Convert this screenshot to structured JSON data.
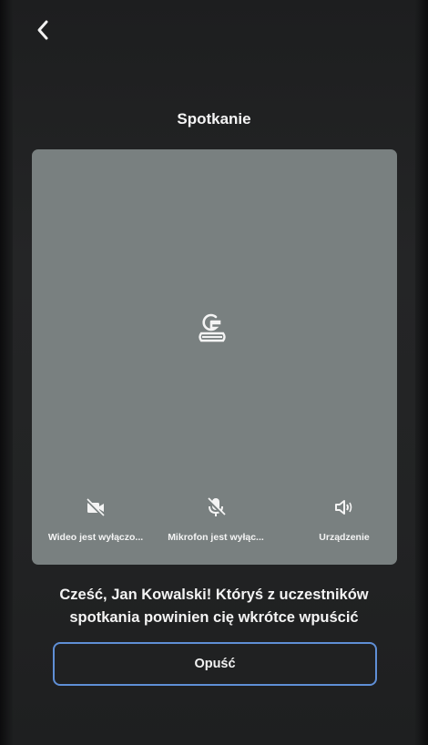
{
  "header": {
    "back_icon": "chevron-left-icon",
    "title": "Spotkanie"
  },
  "preview": {
    "avatar_icon": "user-placeholder-icon"
  },
  "controls": [
    {
      "label": "Wideo jest wyłączo...",
      "icon": "video-off-icon"
    },
    {
      "label": "Mikrofon jest wyłąc...",
      "icon": "microphone-off-icon"
    },
    {
      "label": "Urządzenie",
      "icon": "speaker-icon"
    }
  ],
  "lobby": {
    "message": "Cześć, Jan Kowalski! Któryś z uczestników spotkania powinien cię wkrótce wpuścić",
    "leave_label": "Opuść"
  },
  "colors": {
    "background": "#222324",
    "preview": "#798080",
    "button_border": "#5f8fd6",
    "text": "#f4f4f4"
  }
}
